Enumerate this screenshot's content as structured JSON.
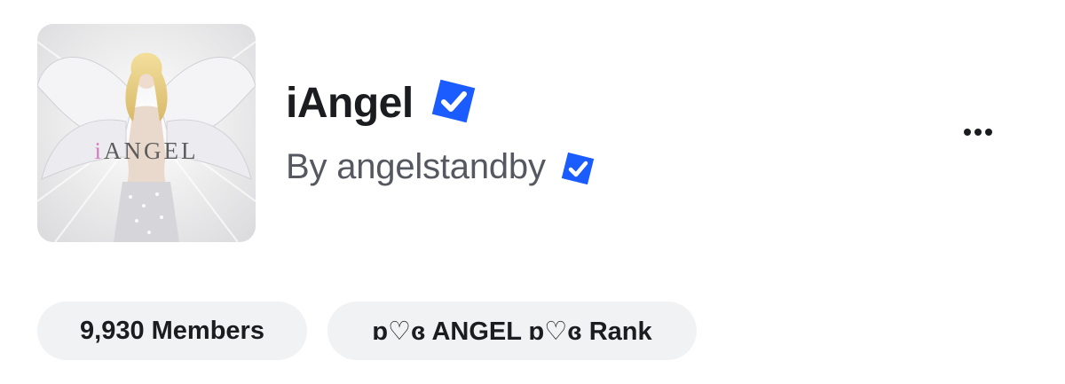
{
  "group": {
    "name": "iAngel",
    "creator_text": "By angelstandby",
    "thumbnail_text_pink": "i",
    "thumbnail_text": "ANGEL"
  },
  "chips": {
    "members": "9,930 Members",
    "rank": "ɒ♡ɞ ANGEL ɒ♡ɞ Rank"
  },
  "icons": {
    "verified": "verified-badge-icon",
    "more": "more-options-icon"
  },
  "colors": {
    "verified_blue": "#1a5cff",
    "chip_background": "#f1f2f4",
    "title_text": "#1b1c1f",
    "subtitle_text": "#555860"
  }
}
